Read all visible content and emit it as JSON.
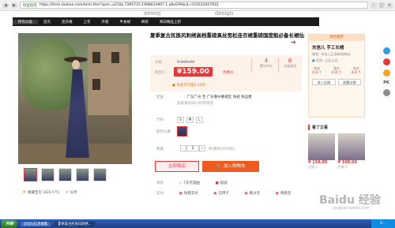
{
  "browser": {
    "address_label": "阿里旺旺",
    "url": "https://item.taobao.com/item.htm?spm=a210p.7395725.1998033907.1.y8vGPA&id=525522027932"
  },
  "brand": {
    "left": "newig",
    "right": "design"
  },
  "shop_nav": {
    "items": [
      "所有分类",
      "首页",
      "连衣裙",
      "上衣",
      "外套",
      "半身裙",
      "裤装",
      "每日精品上新"
    ]
  },
  "product": {
    "title": "夏季复古民族风刺绣高档重磅真丝宽松连衣裙重磅国度般必备长裙仙",
    "price_label": "价格",
    "original_price": "¥ 399.00",
    "promo_label": "淘宝价",
    "promo_price": "¥159.00",
    "promo_tag": "优惠价",
    "stats": [
      {
        "num": "4",
        "label": "累计评价"
      },
      {
        "num": "8",
        "label": "交易成功"
      }
    ],
    "coupon": "淘金币可抵3.18元",
    "shipping_label": "配送",
    "shipping_value": "广东广州 至  广东惠州惠城区 快递 免运费",
    "shipping_sub": "卖家承诺48小时内发货",
    "size_label": "尺码",
    "sizes": [
      "S",
      "M",
      "L"
    ],
    "color_label": "颜色分类",
    "qty_label": "数量",
    "qty_value": "1",
    "qty_note": "件(库存2976件)",
    "buy_now": "立即购买",
    "add_cart": "加入购物车",
    "promise_label": "承诺",
    "promise_value": "7天无理由",
    "promise_value2": "极速",
    "pay_label": "支付",
    "pay_items": [
      "快捷支付",
      "信用卡",
      "集分宝",
      "余额宝"
    ]
  },
  "gallery": {
    "favorite": "收藏宝贝 (422人气)",
    "share": "分享"
  },
  "seller": {
    "header": "掌柜推荐",
    "name": "东信儿 手工长裙",
    "line1": "掌柜: 东信儿王高新刚商店",
    "line2": "资质: 企业认证",
    "ratings": [
      {
        "label": "描述",
        "value": "4.8 ↑"
      },
      {
        "label": "服务",
        "value": "4.8 ↑"
      },
      {
        "label": "物流",
        "value": "4.8 ↑"
      }
    ],
    "btn_enter": "进入店铺",
    "btn_fav": "收藏店铺"
  },
  "see_also": {
    "title": "看了又看",
    "items": [
      {
        "price": "¥ 158.00",
        "sales": "月销 1"
      },
      {
        "price": "¥ 168.00",
        "sales": "月销 3"
      },
      {
        "price": "¥ 168.00",
        "sales": ""
      },
      {
        "price": "¥ 158.00",
        "sales": ""
      }
    ]
  },
  "dock": {
    "pk": "PK"
  },
  "taskbar": {
    "start": "开始",
    "items": [
      "启动与信息收集",
      "夏季复古民族风刺绣..."
    ],
    "tray": "3:..."
  },
  "watermark": {
    "main": "Baidu 经验",
    "sub": "jingyan.baidu.com"
  },
  "colors": {
    "accent": "#e4393c",
    "cart": "#f25b1f",
    "nav": "#1b1b1b"
  }
}
